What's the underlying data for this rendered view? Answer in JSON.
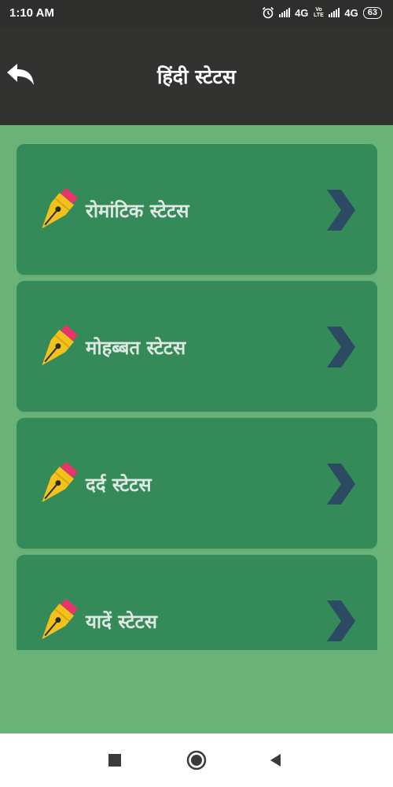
{
  "status_bar": {
    "time": "1:10 AM",
    "network_1": "4G",
    "network_2": "4G",
    "battery": "63",
    "volte": "Vo LTE",
    "alarm_icon": "alarm-icon"
  },
  "header": {
    "title": "हिंदी स्टेटस",
    "back_icon": "back-arrow-icon"
  },
  "categories": [
    {
      "label": "रोमांटिक स्टेटस",
      "icon": "pen-nib-icon",
      "arrow": "chevron-right-icon"
    },
    {
      "label": "मोहब्बत स्टेटस",
      "icon": "pen-nib-icon",
      "arrow": "chevron-right-icon"
    },
    {
      "label": "दर्द स्टेटस",
      "icon": "pen-nib-icon",
      "arrow": "chevron-right-icon"
    },
    {
      "label": "यादें स्टेटस",
      "icon": "pen-nib-icon",
      "arrow": "chevron-right-icon"
    }
  ],
  "nav_bar": {
    "recents_icon": "square-icon",
    "home_icon": "circle-icon",
    "back_icon": "triangle-back-icon"
  },
  "colors": {
    "status_bar_bg": "#2e2f2c",
    "header_bg": "#323330",
    "content_bg": "#6ab378",
    "card_bg": "#358a5a",
    "card_text": "#dfe8e2",
    "chevron": "#2d4a63",
    "pen_gold": "#f2c21b",
    "pen_pink": "#e8336b"
  }
}
